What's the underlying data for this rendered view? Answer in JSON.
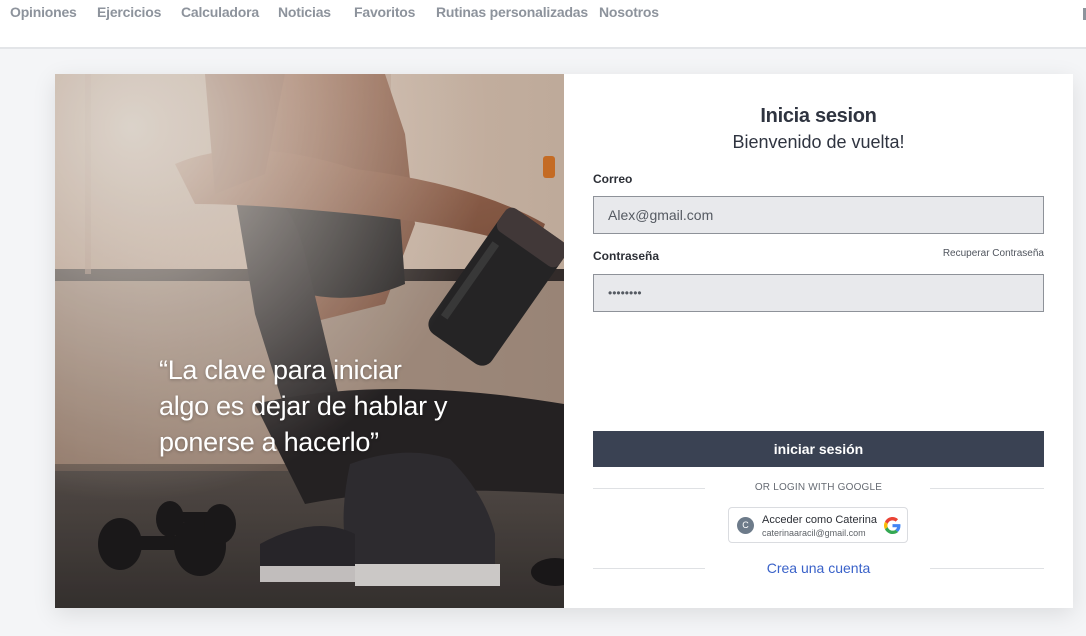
{
  "nav": {
    "items": [
      "Opiniones",
      "Ejercicios",
      "Calculadora",
      "Noticias",
      "Favoritos",
      "Rutinas personalizadas",
      "Nosotros"
    ]
  },
  "hero": {
    "quote_lines": [
      "“La clave para iniciar",
      "algo es dejar de hablar y",
      "ponerse a hacerlo”"
    ]
  },
  "form": {
    "title": "Inicia sesion",
    "subtitle": "Bienvenido de vuelta!",
    "email_label": "Correo",
    "email_value": "Alex@gmail.com",
    "password_label": "Contraseña",
    "recover_link": "Recuperar Contraseña",
    "password_value": "••••••••",
    "submit_label": "iniciar sesión",
    "or_text": "OR LOGIN WITH GOOGLE",
    "google": {
      "avatar_letter": "C",
      "name": "Acceder como Caterina",
      "email": "caterinaaracil@gmail.com"
    },
    "create_account": "Crea una cuenta"
  },
  "colors": {
    "primary_button": "#3a4253",
    "link": "#3a62c9",
    "nav_text": "#8d939c"
  }
}
